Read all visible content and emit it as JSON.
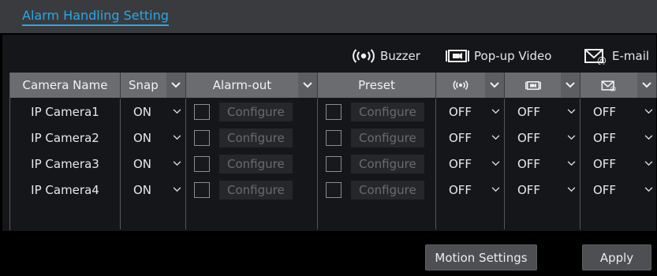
{
  "header": {
    "title": "Alarm Handling Setting"
  },
  "legend": {
    "buzzer": {
      "label": "Buzzer",
      "icon": "buzzer-icon"
    },
    "popup": {
      "label": "Pop-up Video",
      "icon": "popup-video-icon"
    },
    "email": {
      "label": "E-mail",
      "icon": "email-icon"
    }
  },
  "table": {
    "columns": {
      "camera_name": "Camera Name",
      "snap": "Snap",
      "alarm_out": "Alarm-out",
      "preset": "Preset"
    },
    "rows": [
      {
        "name": "IP Camera1",
        "snap": "ON",
        "alarm_out": "Configure",
        "preset": "Configure",
        "buzzer": "OFF",
        "popup": "OFF",
        "email": "OFF"
      },
      {
        "name": "IP Camera2",
        "snap": "ON",
        "alarm_out": "Configure",
        "preset": "Configure",
        "buzzer": "OFF",
        "popup": "OFF",
        "email": "OFF"
      },
      {
        "name": "IP Camera3",
        "snap": "ON",
        "alarm_out": "Configure",
        "preset": "Configure",
        "buzzer": "OFF",
        "popup": "OFF",
        "email": "OFF"
      },
      {
        "name": "IP Camera4",
        "snap": "ON",
        "alarm_out": "Configure",
        "preset": "Configure",
        "buzzer": "OFF",
        "popup": "OFF",
        "email": "OFF"
      }
    ]
  },
  "buttons": {
    "motion_settings": "Motion Settings",
    "apply": "Apply"
  },
  "colors": {
    "accent": "#2aa7e6",
    "header_bg": "#3a3b3e",
    "table_header_bg": "#6b6c70"
  }
}
